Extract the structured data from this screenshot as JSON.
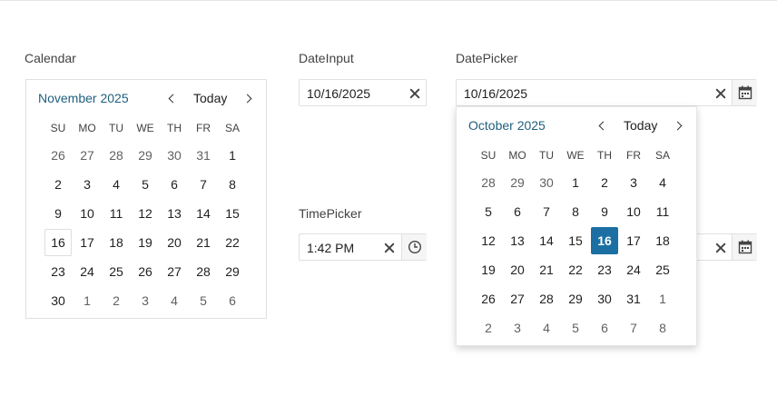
{
  "labels": {
    "calendar": "Calendar",
    "dateinput": "DateInput",
    "datepicker": "DatePicker",
    "timepicker": "TimePicker"
  },
  "calendar": {
    "title": "November 2025",
    "today_label": "Today",
    "weekdays": [
      "SU",
      "MO",
      "TU",
      "WE",
      "TH",
      "FR",
      "SA"
    ],
    "weeks": [
      [
        {
          "d": "26",
          "o": true
        },
        {
          "d": "27",
          "o": true
        },
        {
          "d": "28",
          "o": true
        },
        {
          "d": "29",
          "o": true
        },
        {
          "d": "30",
          "o": true
        },
        {
          "d": "31",
          "o": true
        },
        {
          "d": "1"
        }
      ],
      [
        {
          "d": "2"
        },
        {
          "d": "3"
        },
        {
          "d": "4"
        },
        {
          "d": "5"
        },
        {
          "d": "6"
        },
        {
          "d": "7"
        },
        {
          "d": "8"
        }
      ],
      [
        {
          "d": "9"
        },
        {
          "d": "10"
        },
        {
          "d": "11"
        },
        {
          "d": "12"
        },
        {
          "d": "13"
        },
        {
          "d": "14"
        },
        {
          "d": "15"
        }
      ],
      [
        {
          "d": "16",
          "today": true
        },
        {
          "d": "17"
        },
        {
          "d": "18"
        },
        {
          "d": "19"
        },
        {
          "d": "20"
        },
        {
          "d": "21"
        },
        {
          "d": "22"
        }
      ],
      [
        {
          "d": "23"
        },
        {
          "d": "24"
        },
        {
          "d": "25"
        },
        {
          "d": "26"
        },
        {
          "d": "27"
        },
        {
          "d": "28"
        },
        {
          "d": "29"
        }
      ],
      [
        {
          "d": "30"
        },
        {
          "d": "1",
          "o": true
        },
        {
          "d": "2",
          "o": true
        },
        {
          "d": "3",
          "o": true
        },
        {
          "d": "4",
          "o": true
        },
        {
          "d": "5",
          "o": true
        },
        {
          "d": "6",
          "o": true
        }
      ]
    ]
  },
  "dateinput": {
    "value": "10/16/2025"
  },
  "datepicker": {
    "value": "10/16/2025"
  },
  "timepicker": {
    "value": "1:42 PM"
  },
  "popup": {
    "title": "October 2025",
    "today_label": "Today",
    "weekdays": [
      "SU",
      "MO",
      "TU",
      "WE",
      "TH",
      "FR",
      "SA"
    ],
    "weeks": [
      [
        {
          "d": "28",
          "o": true
        },
        {
          "d": "29",
          "o": true
        },
        {
          "d": "30",
          "o": true
        },
        {
          "d": "1"
        },
        {
          "d": "2"
        },
        {
          "d": "3"
        },
        {
          "d": "4"
        }
      ],
      [
        {
          "d": "5"
        },
        {
          "d": "6"
        },
        {
          "d": "7"
        },
        {
          "d": "8"
        },
        {
          "d": "9"
        },
        {
          "d": "10"
        },
        {
          "d": "11"
        }
      ],
      [
        {
          "d": "12"
        },
        {
          "d": "13"
        },
        {
          "d": "14"
        },
        {
          "d": "15"
        },
        {
          "d": "16",
          "sel": true
        },
        {
          "d": "17"
        },
        {
          "d": "18"
        }
      ],
      [
        {
          "d": "19"
        },
        {
          "d": "20"
        },
        {
          "d": "21"
        },
        {
          "d": "22"
        },
        {
          "d": "23"
        },
        {
          "d": "24"
        },
        {
          "d": "25"
        }
      ],
      [
        {
          "d": "26"
        },
        {
          "d": "27"
        },
        {
          "d": "28"
        },
        {
          "d": "29"
        },
        {
          "d": "30"
        },
        {
          "d": "31"
        },
        {
          "d": "1",
          "o": true
        }
      ],
      [
        {
          "d": "2",
          "o": true
        },
        {
          "d": "3",
          "o": true
        },
        {
          "d": "4",
          "o": true
        },
        {
          "d": "5",
          "o": true
        },
        {
          "d": "6",
          "o": true
        },
        {
          "d": "7",
          "o": true
        },
        {
          "d": "8",
          "o": true
        }
      ]
    ]
  },
  "icons": {
    "prev": "chevron-left-icon",
    "next": "chevron-right-icon",
    "clear": "close-icon",
    "calendar": "calendar-icon",
    "clock": "clock-icon"
  },
  "colors": {
    "title": "#1f5f7e",
    "selected_bg": "#1b6fa3",
    "border": "#e0e0e0"
  }
}
